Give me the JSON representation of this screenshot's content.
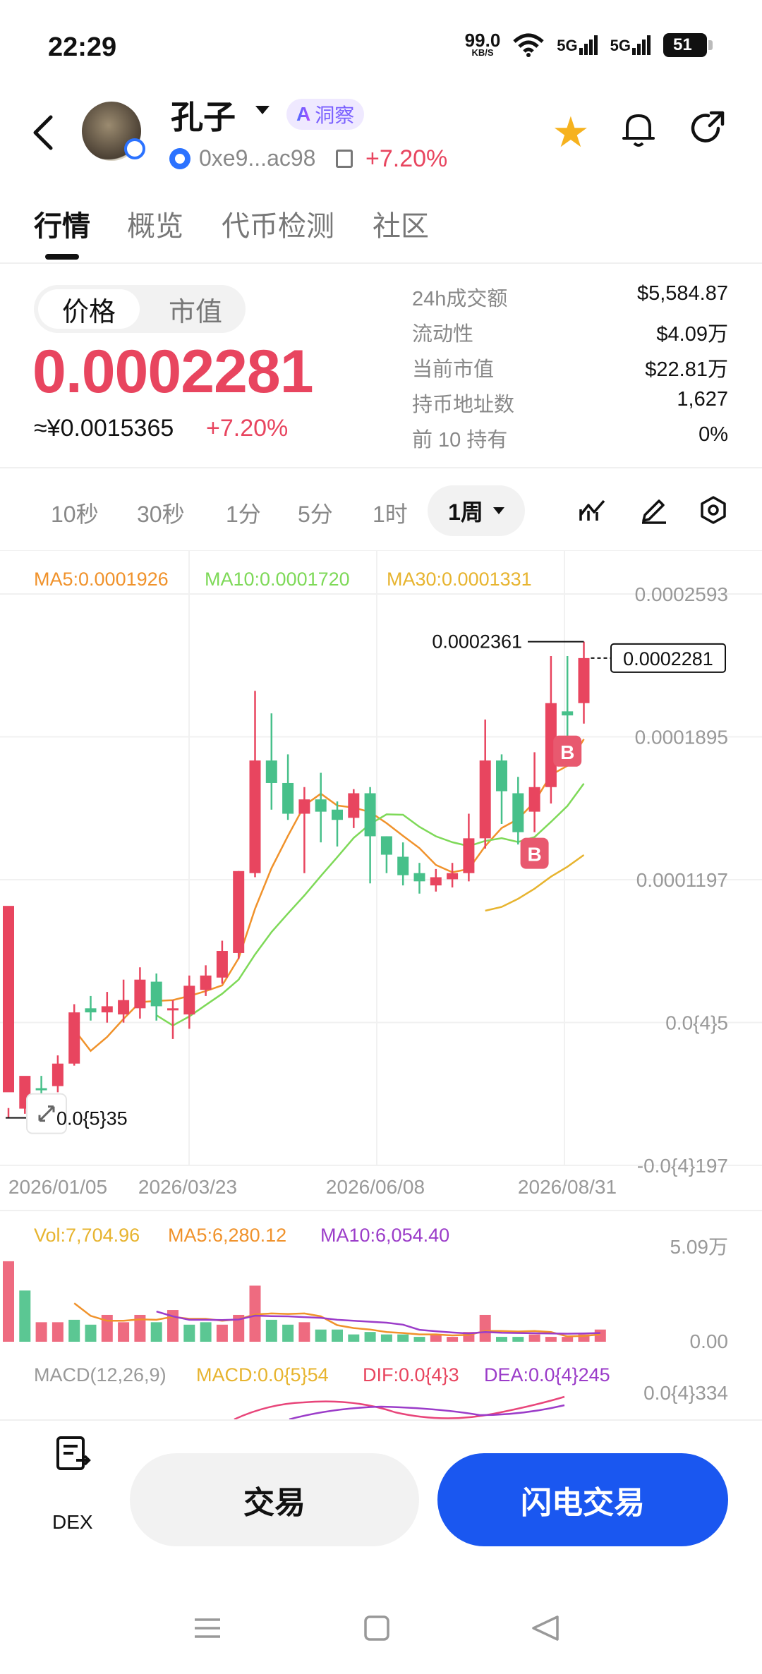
{
  "status_bar": {
    "time": "22:29",
    "net_speed": "99.0",
    "net_unit": "KB/S",
    "signal1": "5G",
    "signal2": "5G",
    "battery": "51"
  },
  "header": {
    "name": "孔子",
    "ai_badge": "A",
    "ai_label": "洞察",
    "address": "0xe9...ac98",
    "change": "+7.20%"
  },
  "tabs": [
    {
      "label": "行情",
      "active": true
    },
    {
      "label": "概览"
    },
    {
      "label": "代币检测"
    },
    {
      "label": "社区"
    }
  ],
  "price_toggle": {
    "on": "价格",
    "off": "市值"
  },
  "price": {
    "value": "0.0002281",
    "cny": "≈¥0.0015365",
    "change": "+7.20%"
  },
  "stats": [
    {
      "label": "24h成交额",
      "value": "$5,584.87"
    },
    {
      "label": "流动性",
      "value": "$4.09万"
    },
    {
      "label": "当前市值",
      "value": "$22.81万"
    },
    {
      "label": "持币地址数",
      "value": "1,627"
    },
    {
      "label": "前 10 持有",
      "value": "0%"
    }
  ],
  "intervals": [
    "10秒",
    "30秒",
    "1分",
    "5分",
    "1时"
  ],
  "active_interval": "1周",
  "colors": {
    "up": "#e8455f",
    "down": "#47c08a",
    "ma5": "#f0922b",
    "ma10": "#7ed958",
    "ma30": "#e7b42f",
    "flash": "#1a57f0"
  },
  "chart_data": {
    "type": "candlestick",
    "ma_legend": {
      "ma5": "MA5:0.0001926",
      "ma10": "MA10:0.0001720",
      "ma30": "MA30:0.0001331"
    },
    "y_ticks": [
      "0.0002593",
      "0.0001895",
      "0.0001197",
      "0.0{4}5",
      "-0.0{4}197"
    ],
    "x_ticks": [
      "2026/01/05",
      "2026/03/23",
      "2026/06/08",
      "2026/08/31"
    ],
    "y_range": [
      -1.97e-05,
      0.0002593
    ],
    "high_label": "0.0002361",
    "current_label": "0.0002281",
    "low_label": "0.0{5}35",
    "candles": [
      [
        1.6e-05,
        0.000107,
        3.5e-06,
        8.3e-06
      ],
      [
        8e-06,
        2.4e-05,
        5.5e-06,
        1.2e-05
      ],
      [
        1.8e-05,
        1.7e-05,
        1.4e-05,
        2.4e-05
      ],
      [
        1.9e-05,
        3e-05,
        1.6e-05,
        3.4e-05
      ],
      [
        3e-05,
        5.5e-05,
        2.9e-05,
        5.9e-05
      ],
      [
        5.7e-05,
        5.5e-05,
        5.1e-05,
        6.3e-05
      ],
      [
        5.5e-05,
        5.8e-05,
        5e-05,
        6.5e-05
      ],
      [
        5.4e-05,
        6.1e-05,
        5e-05,
        7.1e-05
      ],
      [
        5.7e-05,
        7.1e-05,
        5.2e-05,
        7.7e-05
      ],
      [
        7e-05,
        5.8e-05,
        5.1e-05,
        7.4e-05
      ],
      [
        5.6e-05,
        5.7e-05,
        4.2e-05,
        6.1e-05
      ],
      [
        5.4e-05,
        6.8e-05,
        4.7e-05,
        7.3e-05
      ],
      [
        6.6e-05,
        7.3e-05,
        6.3e-05,
        7.8e-05
      ],
      [
        7.2e-05,
        8.5e-05,
        6.9e-05,
        9e-05
      ],
      [
        8.4e-05,
        0.000124,
        8.1e-05,
        0.000124
      ],
      [
        0.000123,
        0.000178,
        0.000121,
        0.000212
      ],
      [
        0.000178,
        0.000167,
        0.000154,
        0.000201
      ],
      [
        0.000167,
        0.000152,
        0.000149,
        0.000181
      ],
      [
        0.000152,
        0.000159,
        0.000123,
        0.000165
      ],
      [
        0.000159,
        0.000153,
        0.000138,
        0.000172
      ],
      [
        0.000154,
        0.000149,
        0.000136,
        0.000158
      ],
      [
        0.00015,
        0.000162,
        0.000145,
        0.000164
      ],
      [
        0.000162,
        0.000141,
        0.000118,
        0.000165
      ],
      [
        0.000141,
        0.000132,
        0.000123,
        0.000141
      ],
      [
        0.000131,
        0.000122,
        0.000117,
        0.000138
      ],
      [
        0.000123,
        0.000119,
        0.000113,
        0.000128
      ],
      [
        0.000117,
        0.000121,
        0.000114,
        0.000125
      ],
      [
        0.00012,
        0.000123,
        0.000116,
        0.000128
      ],
      [
        0.000123,
        0.00014,
        0.000119,
        0.000152
      ],
      [
        0.00014,
        0.000178,
        0.000135,
        0.000198
      ],
      [
        0.000178,
        0.000163,
        0.000147,
        0.000181
      ],
      [
        0.000162,
        0.000143,
        0.000137,
        0.00017
      ],
      [
        0.000153,
        0.000165,
        0.000143,
        0.000182
      ],
      [
        0.000165,
        0.000206,
        0.000157,
        0.000229
      ],
      [
        0.000202,
        0.0002,
        0.000186,
        0.000229
      ],
      [
        0.000206,
        0.000228,
        0.000196,
        0.000236
      ]
    ],
    "markers": [
      {
        "label": "B",
        "index": 32
      },
      {
        "label": "B",
        "index": 34
      }
    ]
  },
  "volume": {
    "legend": {
      "vol": "Vol:7,704.96",
      "ma5": "MA5:6,280.12",
      "ma10": "MA10:6,054.40"
    },
    "y_ticks": [
      "5.09万",
      "0.00"
    ],
    "values": [
      33000,
      21000,
      8000,
      8000,
      9000,
      7000,
      11000,
      8000,
      11000,
      8000,
      13000,
      7000,
      8000,
      7000,
      11000,
      23000,
      9000,
      7000,
      8000,
      5000,
      5000,
      3000,
      4000,
      3000,
      3000,
      2000,
      3000,
      2000,
      4000,
      11000,
      2000,
      2000,
      3000,
      2000,
      2000,
      3000,
      5000
    ],
    "up": [
      true,
      false,
      true,
      true,
      false,
      false,
      true,
      true,
      true,
      false,
      true,
      false,
      false,
      true,
      true,
      true,
      false,
      false,
      true,
      false,
      false,
      false,
      false,
      false,
      false,
      false,
      true,
      true,
      true,
      true,
      false,
      false,
      true,
      true,
      true,
      true,
      true
    ]
  },
  "macd": {
    "title": "MACD(12,26,9)",
    "macd": "MACD:0.0{5}54",
    "dif": "DIF:0.0{4}3",
    "dea": "DEA:0.0{4}245",
    "y_tick": "0.0{4}334"
  },
  "bottom": {
    "dex_label": "DEX",
    "trade": "交易",
    "flash_trade": "闪电交易"
  }
}
